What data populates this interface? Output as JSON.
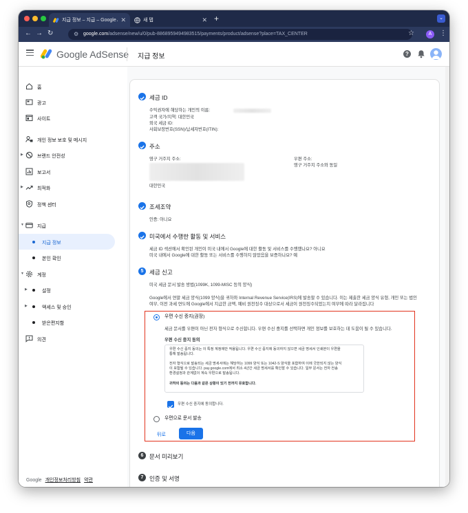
{
  "browser": {
    "tabs": [
      {
        "title": "지급 정보 – 지급 – Google AdSe"
      },
      {
        "title": "새 탭"
      }
    ],
    "url_domain": "google.com",
    "url_path": "/adsense/new/u/0/pub-8868959494983515/payments/product/adsense?place=TAX_CENTER",
    "profile_initial": "A"
  },
  "header": {
    "brand": "Google AdSense",
    "page_title": "지급 정보",
    "help_glyph": "?"
  },
  "sidebar": {
    "items": [
      {
        "label": "홈",
        "icon": "home-icon"
      },
      {
        "label": "광고",
        "icon": "ads-icon"
      },
      {
        "label": "사이트",
        "icon": "sites-icon"
      },
      {
        "label": "개인 정보 보호 및 메시지",
        "icon": "privacy-icon"
      },
      {
        "label": "브랜드 안전성",
        "icon": "block-icon"
      },
      {
        "label": "보고서",
        "icon": "reports-icon"
      },
      {
        "label": "최적화",
        "icon": "trending-icon"
      },
      {
        "label": "정책 센터",
        "icon": "policy-icon"
      },
      {
        "label": "지급",
        "icon": "payments-icon"
      },
      {
        "label": "지급 정보"
      },
      {
        "label": "본인 확인"
      },
      {
        "label": "계정",
        "icon": "gear-icon"
      },
      {
        "label": "설정"
      },
      {
        "label": "액세스 및 승인"
      },
      {
        "label": "받은편지함"
      },
      {
        "label": "의견",
        "icon": "feedback-icon"
      }
    ],
    "footer": {
      "google": "Google",
      "privacy": "개인정보처리방침",
      "terms": "약관"
    }
  },
  "steps": {
    "tax_id": {
      "title": "세금 ID",
      "payee_name_label": "수익권자에 해당하는 개인의 이름:",
      "country": "고객 국가/지역: 대한민국",
      "foreign_tax_id": "외국 세금 ID:",
      "ssn_itin": "사회보장번호(SSN)/납세자번호(ITIN):"
    },
    "address": {
      "title": "주소",
      "permanent_label": "영구 거주지 주소:",
      "permanent_country": "대한민국",
      "mailing_label": "우편 주소:",
      "mailing_value": "영구 거주지 주소와 동일"
    },
    "treaty": {
      "title": "조세조약",
      "line": "인증: 아니요"
    },
    "us_activity": {
      "title": "미국에서 수행한 활동 및 서비스",
      "line1": "세금 ID 섹션에서 확인된 개인이 미국 내에서 Google에 대한 활동 및 서비스를 수행했나요? 아니요",
      "line2": "미국 내에서 Google에 대한 활동 또는 서비스를 수행하지 않았음을 보증하나요? 예"
    },
    "tax_report": {
      "number": "5",
      "title": "세금 신고",
      "subtitle": "미국 세금 문서 발송 방법(1099K, 1099-MISC 등의 양식)",
      "desc1": "Google에서 연말 세금 양식(1099 양식)을 귀하와 Internal Revenue Service(IRS)에 발송할 수 있습니다. 이는 제출한 세금 양식 유형, 개인 또는 법인",
      "desc2": "여부, 이전 과세 연도에 Google에서 지급한 금액, 예비 원천징수 대상으로서 세금이 원천징수되었는지 여부에 따라 달라집니다",
      "option_paperless": "우편 수신 중지(권장)",
      "option_paperless_desc": "세금 문서를 우편이 아닌 전자 형식으로 수신합니다. 우편 수신 중지를 선택하면 개인 정보를 보호하는 데 도움이 될 수 있습니다.",
      "consent_title": "우편 수신 중지 동의",
      "consent_p1a": "우편 수신 중지 동의는 이 특정 계정에만 적용됩니다. 우편 수신 중지에 동의하지 않으면 세금 명세서 인쇄본이 우편을",
      "consent_p1b": "통해 발송됩니다.",
      "consent_p2a": "전자 형식으로 발송되는 세금 명세서에는 해당하는 1099 양식 또는 1042-S 양식을 포함하여 이에 국한되지 않는 양식",
      "consent_p2b": "이 포함될 수 있습니다. pay.google.com에서 최소 4년간 세금 명세서를 확인할 수 있습니다. 일부 문서는 전자 전송",
      "consent_p2c": "환경설정과 관계없이 계속 우편으로 발송됩니다.",
      "consent_p3": "귀하의 동의는 다음과 같은 상황이 있기 전까지 유효합니다.",
      "consent_checkbox": "우편 수신 중지에 동의합니다.",
      "option_mail": "우편으로 문서 발송",
      "back": "뒤로",
      "next": "다음"
    },
    "preview": {
      "number": "6",
      "title": "문서 미리보기"
    },
    "sign": {
      "number": "7",
      "title": "인증 및 서명"
    }
  },
  "colors": {
    "accent": "#1a73e8",
    "highlight": "#e2321c",
    "check": "#1a73e8"
  }
}
